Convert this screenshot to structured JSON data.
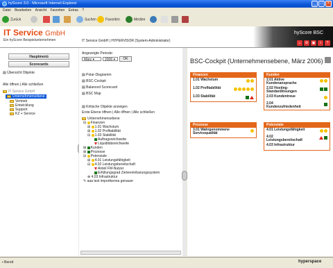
{
  "window": {
    "title": "hyScore 3.0 - Microsoft Internet Explorer"
  },
  "menu": [
    "Datei",
    "Bearbeiten",
    "Ansicht",
    "Favoriten",
    "Extras",
    "?"
  ],
  "toolbar": {
    "back": "Zurück",
    "search": "Suchen",
    "favorites": "Favoriten",
    "media": "Medien"
  },
  "header": {
    "logo_main": "IT Service",
    "logo_suffix": "GmbH",
    "logo_sub": "Ein hyScore Beispielunternehmen",
    "breadcrumb": "IT Service GmbH | HYPERVISOR (System-Administrator)",
    "brand": "hyScore BSC"
  },
  "left": {
    "menu_button": "Hauptmenü",
    "scorecards_button": "Scorecards",
    "overview_link": "Übersicht Objekte",
    "expand_collapse": "Alle öffnen | Alle schließen",
    "tree": [
      "IT Service GmbH",
      "Unternehmensebene",
      "Vertrieb",
      "Entwicklung",
      "Support",
      "KZ + Service"
    ]
  },
  "middle": {
    "period_label": "Angezeigte Periode:",
    "month": "März",
    "year": "2006",
    "ok": "OK",
    "links": [
      "Polar-Diagramm",
      "BSC-Cockpit",
      "Balanced Scorecard",
      "BSC Map"
    ],
    "critical": "Kritische Objekte anzeigen",
    "level_expand": "Erste Ebene öffnen | Alle öffnen | Alle schließen",
    "tree": [
      "Unternehmensebene",
      "Finanzen",
      "1.01 Wachstum",
      "1.02 Profitabilität",
      "1.03 Stabilität",
      "Auftragsreichweite",
      "Liquiditätsreichweite",
      "Kunden",
      "Prozesse",
      "Potenziale",
      "4.01 Leistungsfähigkeit",
      "4.02 Leistungsbereitschaft",
      "Anteil FM-Nutzer",
      "Erfüllungsgrad Zielvereinbarungssystem",
      "4.03 Infrastruktur",
      "aaa test importkenna genauer"
    ]
  },
  "right": {
    "title": "BSC-Cockpit (Unternehmensebene, März 2006)",
    "cards": [
      {
        "name": "Finanzen",
        "rows": [
          {
            "label": "1.01 Wachstum",
            "marks": [
              "dot",
              "dot"
            ]
          },
          {
            "label": "1.02 Profitabilität",
            "marks": [
              "dot",
              "dot",
              "dot",
              "dot",
              "dot"
            ]
          },
          {
            "label": "1.03 Stabilität",
            "marks": [
              "gsq",
              "rtri"
            ]
          }
        ]
      },
      {
        "name": "Kunden",
        "rows": [
          {
            "label": "2.01 Aktive Kundenansprache",
            "marks": [
              "dot",
              "dot"
            ]
          },
          {
            "label": "2.02 Hosting-Standardlösungen",
            "marks": [
              "gsq",
              "gsq"
            ]
          },
          {
            "label": "2.03 Kundentreue",
            "marks": [
              "dot"
            ]
          },
          {
            "label": "2.04 Kundenzufriedenheit",
            "marks": [
              "gsq"
            ]
          }
        ]
      },
      {
        "name": "Prozesse",
        "rows": [
          {
            "label": "3.01 Wahrgenommene Servicequalität",
            "marks": [
              "dot"
            ]
          }
        ]
      },
      {
        "name": "Potenziale",
        "rows": [
          {
            "label": "4.01 Leistungsfähigkeit",
            "marks": [
              "dot",
              "dot"
            ]
          },
          {
            "label": "4.02 Leistungsbereitschaft",
            "marks": [
              "rtri",
              "gsq"
            ]
          },
          {
            "label": "4.03 Infrastruktur",
            "marks": []
          }
        ]
      }
    ]
  },
  "status": {
    "text": "Bereit",
    "brand": "hyperspace"
  },
  "colors": {
    "accent": "#e3661a",
    "xp_blue": "#0a56d8"
  }
}
